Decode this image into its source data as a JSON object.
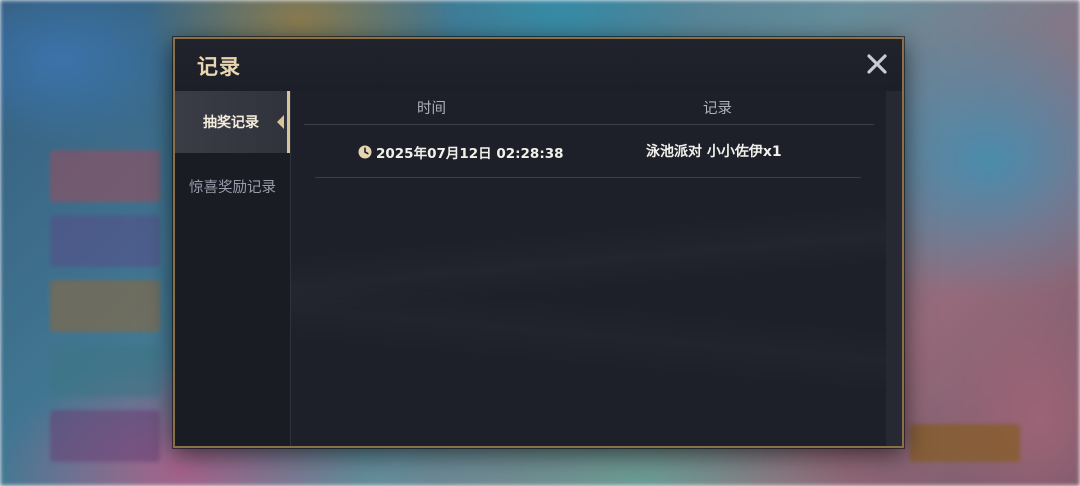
{
  "dialog": {
    "title": "记录",
    "close_icon": "close-icon"
  },
  "sidebar": {
    "tabs": [
      {
        "label": "抽奖记录",
        "active": true
      },
      {
        "label": "惊喜奖励记录",
        "active": false
      }
    ]
  },
  "table": {
    "columns": [
      "时间",
      "记录"
    ],
    "rows": [
      {
        "time": "2025年07月12日 02:28:38",
        "record": "泳池派对 小小佐伊x1",
        "icon": "clock-icon"
      }
    ]
  },
  "colors": {
    "accent_gold": "#d8c49a",
    "frame_border": "#8a7048",
    "panel_bg": "#1c1e28"
  }
}
